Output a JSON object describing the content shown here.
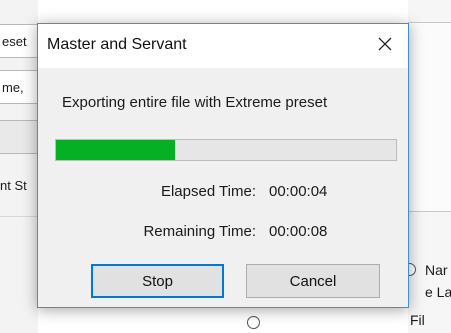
{
  "background": {
    "left_fragments": [
      "eset",
      "me,",
      "nt St"
    ],
    "right_fragments": [
      "Nar",
      "e Lab",
      "Fil"
    ]
  },
  "dialog": {
    "title": "Master and Servant",
    "message": "Exporting entire file with Extreme preset",
    "progress": 0.35,
    "progress_color": "#06b025",
    "elapsed_label": "Elapsed Time:",
    "elapsed_value": "00:00:04",
    "remaining_label": "Remaining Time:",
    "remaining_value": "00:00:08",
    "stop_label": "Stop",
    "cancel_label": "Cancel",
    "close_icon": "close-icon"
  }
}
